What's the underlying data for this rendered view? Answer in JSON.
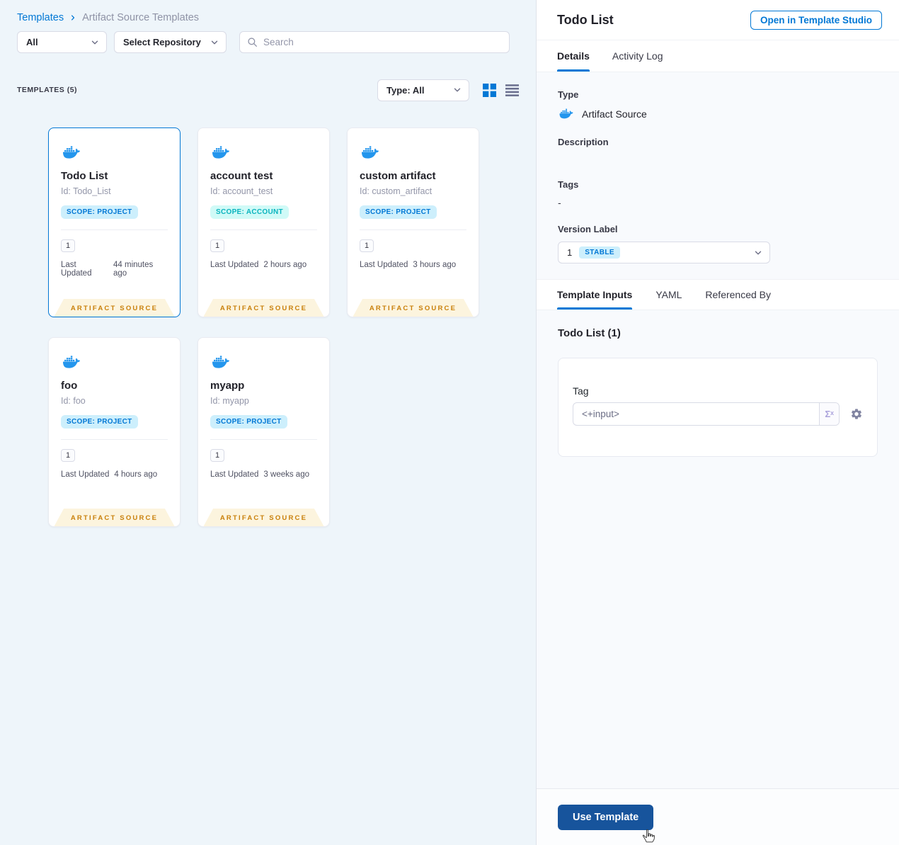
{
  "palette": {
    "primary_blue": "#0278D5",
    "docker_blue": "#2496ED",
    "scope_project_bg": "#CDEFFC",
    "scope_project_text": "#0278D5",
    "scope_account_bg": "#D0FAF7",
    "scope_account_text": "#0AB4BE",
    "artifact_ribbon_bg": "#FCF4DE",
    "artifact_ribbon_text": "#C9800B",
    "use_template_button_bg": "#17549C"
  },
  "breadcrumb": {
    "parent": "Templates",
    "current": "Artifact Source Templates"
  },
  "filters": {
    "scope_dropdown_value": "All",
    "repository_dropdown_value": "Select Repository",
    "search_placeholder": "Search"
  },
  "list_header": {
    "count_label": "TEMPLATES (5)",
    "type_filter_value": "Type: All"
  },
  "cards": [
    {
      "title": "Todo List",
      "id": "Id: Todo_List",
      "scope_badge": "SCOPE: PROJECT",
      "version": "1",
      "last_updated_label": "Last Updated",
      "last_updated_value": "44 minutes ago",
      "type_ribbon": "ARTIFACT SOURCE"
    },
    {
      "title": "account test",
      "id": "Id: account_test",
      "scope_badge": "SCOPE: ACCOUNT",
      "version": "1",
      "last_updated_label": "Last Updated",
      "last_updated_value": "2 hours ago",
      "type_ribbon": "ARTIFACT SOURCE"
    },
    {
      "title": "custom artifact",
      "id": "Id: custom_artifact",
      "scope_badge": "SCOPE: PROJECT",
      "version": "1",
      "last_updated_label": "Last Updated",
      "last_updated_value": "3 hours ago",
      "type_ribbon": "ARTIFACT SOURCE"
    },
    {
      "title": "foo",
      "id": "Id: foo",
      "scope_badge": "SCOPE: PROJECT",
      "version": "1",
      "last_updated_label": "Last Updated",
      "last_updated_value": "4 hours ago",
      "type_ribbon": "ARTIFACT SOURCE"
    },
    {
      "title": "myapp",
      "id": "Id: myapp",
      "scope_badge": "SCOPE: PROJECT",
      "version": "1",
      "last_updated_label": "Last Updated",
      "last_updated_value": "3 weeks ago",
      "type_ribbon": "ARTIFACT SOURCE"
    }
  ],
  "details_panel": {
    "title": "Todo List",
    "open_studio_button": "Open in Template Studio",
    "tabs": [
      "Details",
      "Activity Log"
    ],
    "type_label": "Type",
    "type_value": "Artifact Source",
    "description_label": "Description",
    "tags_label": "Tags",
    "tags_value": "-",
    "version_label": "Version Label",
    "version_value": "1",
    "version_badge": "STABLE",
    "inputs_tabs": [
      "Template Inputs",
      "YAML",
      "Referenced By"
    ],
    "inputs_heading": "Todo List (1)",
    "tag_field_label": "Tag",
    "tag_input_value": "<+input>",
    "expression_symbol": "Σˣ",
    "use_template_button": "Use Template"
  }
}
